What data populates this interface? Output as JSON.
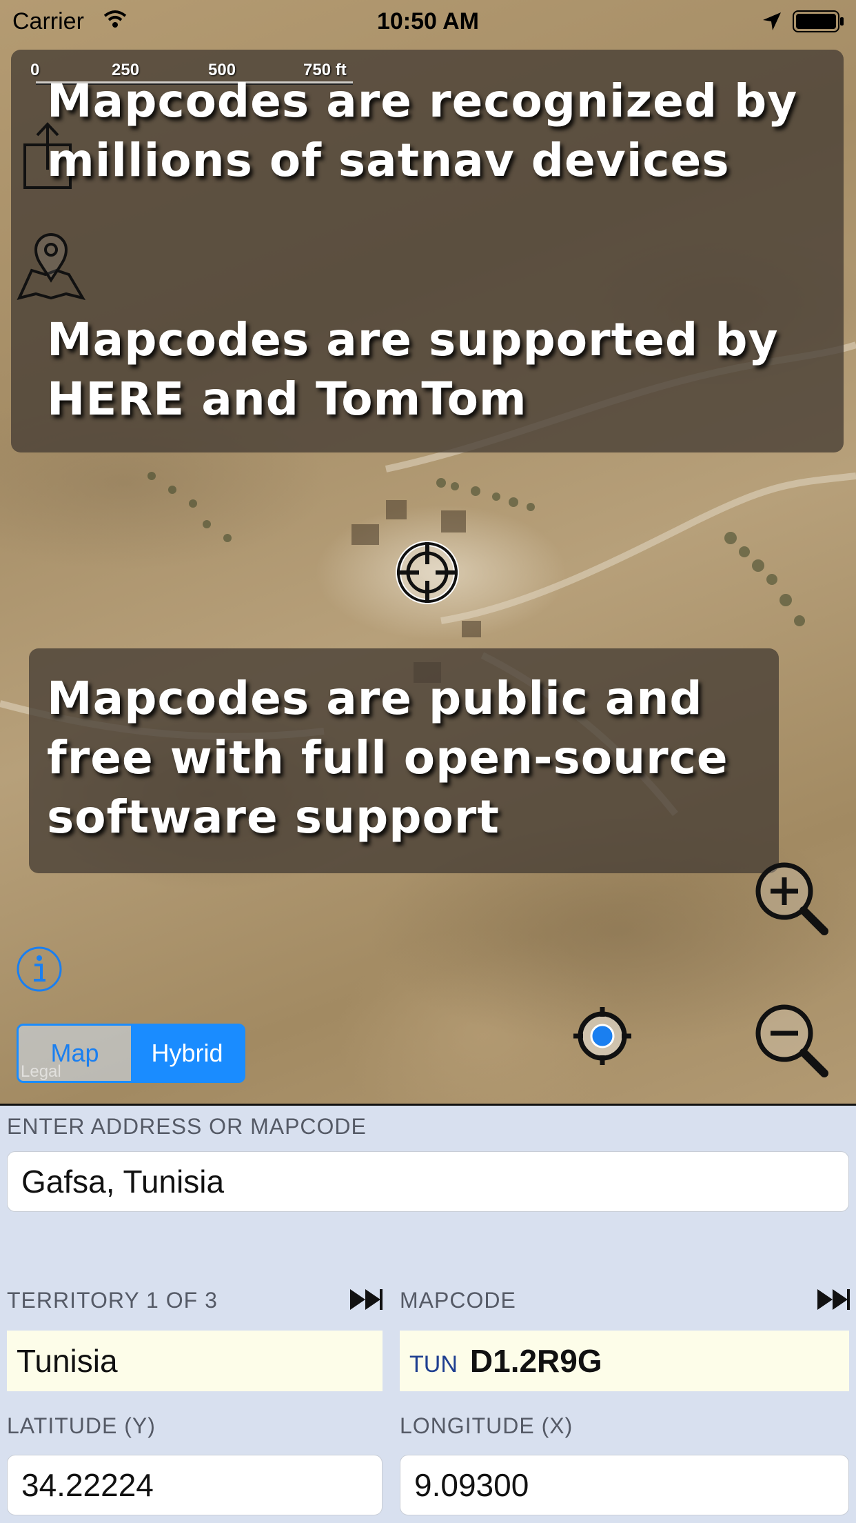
{
  "status_bar": {
    "carrier": "Carrier",
    "time": "10:50 AM"
  },
  "scale": {
    "ticks": [
      "0",
      "250",
      "500",
      "750 ft"
    ]
  },
  "overlay": {
    "card_top_line1": "Mapcodes are recognized by millions of satnav devices",
    "card_top_line2": "Mapcodes are supported by HERE and TomTom",
    "card_bottom": "Mapcodes are public and free with full open-source software support"
  },
  "map": {
    "legal": "Legal",
    "segments": {
      "map": "Map",
      "hybrid": "Hybrid"
    },
    "selected_segment": "Hybrid"
  },
  "icons": {
    "share": "share-icon",
    "map_pin": "map-pin-icon",
    "crosshair": "crosshair-icon",
    "info": "info-icon",
    "zoom_in": "zoom-in-icon",
    "zoom_out": "zoom-out-icon",
    "my_location": "my-location-icon",
    "next": "fast-forward-icon"
  },
  "form": {
    "address_label": "ENTER ADDRESS OR MAPCODE",
    "address_value": "Gafsa, Tunisia",
    "territory_label": "TERRITORY 1 OF 3",
    "territory_value": "Tunisia",
    "mapcode_label": "MAPCODE",
    "mapcode_prefix": "TUN",
    "mapcode_value": "D1.2R9G",
    "latitude_label": "LATITUDE (Y)",
    "latitude_value": "34.22224",
    "longitude_label": "LONGITUDE (X)",
    "longitude_value": "9.09300"
  },
  "colors": {
    "accent": "#1a8cff",
    "form_background": "#d8e0ef",
    "highlight_field": "#fdfde9"
  }
}
